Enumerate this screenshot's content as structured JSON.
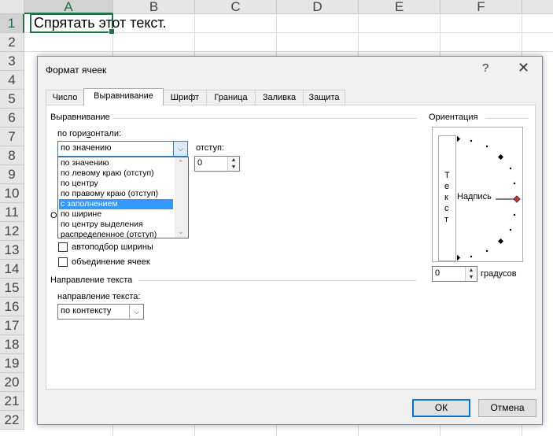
{
  "sheet": {
    "columns": [
      "A",
      "B",
      "C",
      "D",
      "E",
      "F"
    ],
    "rows": [
      "1",
      "2",
      "3",
      "4",
      "5",
      "6",
      "7",
      "8",
      "9",
      "10",
      "11",
      "12",
      "13",
      "14",
      "15",
      "16",
      "17",
      "18",
      "19",
      "20",
      "21",
      "22"
    ],
    "cell_a1": "Спрятать этот текст."
  },
  "dialog": {
    "title": "Формат ячеек",
    "help": "?",
    "close": "✕",
    "tabs": [
      "Число",
      "Выравнивание",
      "Шрифт",
      "Граница",
      "Заливка",
      "Защита"
    ],
    "active_tab": "Выравнивание",
    "alignment_group": "Выравнивание",
    "horizontal_label": "по горизонтали:",
    "horizontal_value": "по значению",
    "indent_label": "отступ:",
    "indent_value": "0",
    "horizontal_options": [
      "по значению",
      "по левому краю (отступ)",
      "по центру",
      "по правому краю (отступ)",
      "с заполнением",
      "по ширине",
      "по центру выделения",
      "распределенное (отступ)"
    ],
    "selected_option": "с заполнением",
    "display_group_partial": "О",
    "autofit_label": "автоподбор ширины",
    "merge_label": "объединение ячеек",
    "direction_group": "Направление текста",
    "direction_label": "направление текста:",
    "direction_value": "по контексту",
    "orientation_group": "Ориентация",
    "vertical_text": [
      "Т",
      "е",
      "к",
      "с",
      "т"
    ],
    "inscription": "Надпись",
    "degrees_value": "0",
    "degrees_label": "градусов",
    "ok": "ОК",
    "cancel": "Отмена"
  },
  "colors": {
    "excel_green": "#217346",
    "selection_blue": "#3399ff",
    "dial_red": "#c0392b"
  }
}
